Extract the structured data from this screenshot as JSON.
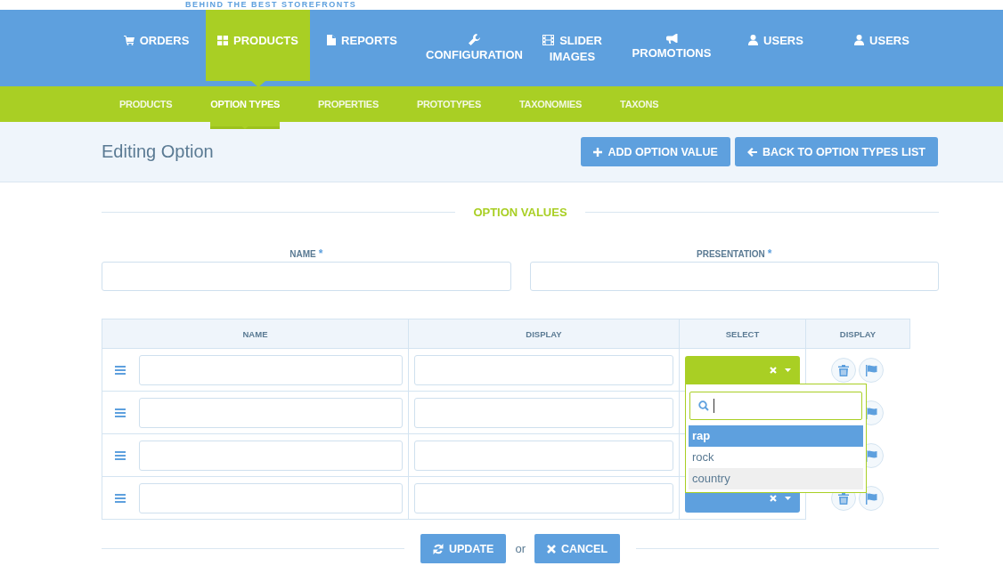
{
  "tagline": "BEHIND THE BEST STOREFRONTS",
  "main_nav": [
    {
      "label": "ORDERS",
      "selected": false
    },
    {
      "label": "PRODUCTS",
      "selected": true
    },
    {
      "label": "REPORTS",
      "selected": false
    },
    {
      "label": "CONFIGURATION",
      "selected": false
    },
    {
      "label": "SLIDER IMAGES",
      "selected": false
    },
    {
      "label": "PROMOTIONS",
      "selected": false
    },
    {
      "label": "USERS",
      "selected": false
    },
    {
      "label": "USERS",
      "selected": false
    }
  ],
  "sub_nav": [
    {
      "label": "PRODUCTS",
      "selected": false
    },
    {
      "label": "OPTION TYPES",
      "selected": true
    },
    {
      "label": "PROPERTIES",
      "selected": false
    },
    {
      "label": "PROTOTYPES",
      "selected": false
    },
    {
      "label": "TAXONOMIES",
      "selected": false
    },
    {
      "label": "TAXONS",
      "selected": false
    }
  ],
  "page_title": "Editing Option",
  "header_buttons": [
    {
      "label": "ADD OPTION VALUE"
    },
    {
      "label": "BACK TO OPTION TYPES LIST"
    }
  ],
  "section_title": "OPTION VALUES",
  "fields": [
    {
      "label": "NAME",
      "required_mark": "*"
    },
    {
      "label": "PRESENTATION",
      "required_mark": "*"
    }
  ],
  "table": {
    "columns": [
      "NAME",
      "DISPLAY",
      "SELECT",
      "DISPLAY"
    ],
    "rows": [
      {
        "select_open": true
      },
      {
        "select_open": false
      },
      {
        "select_open": false
      },
      {
        "select_open": false
      }
    ]
  },
  "dropdown": {
    "options": [
      {
        "label": "rap",
        "selected": true,
        "highlighted": false
      },
      {
        "label": "rock",
        "selected": false,
        "highlighted": false
      },
      {
        "label": "country",
        "selected": false,
        "highlighted": true
      }
    ]
  },
  "footer": {
    "buttons": [
      {
        "label": "UPDATE"
      },
      {
        "label": "CANCEL"
      }
    ],
    "separator": "or"
  }
}
